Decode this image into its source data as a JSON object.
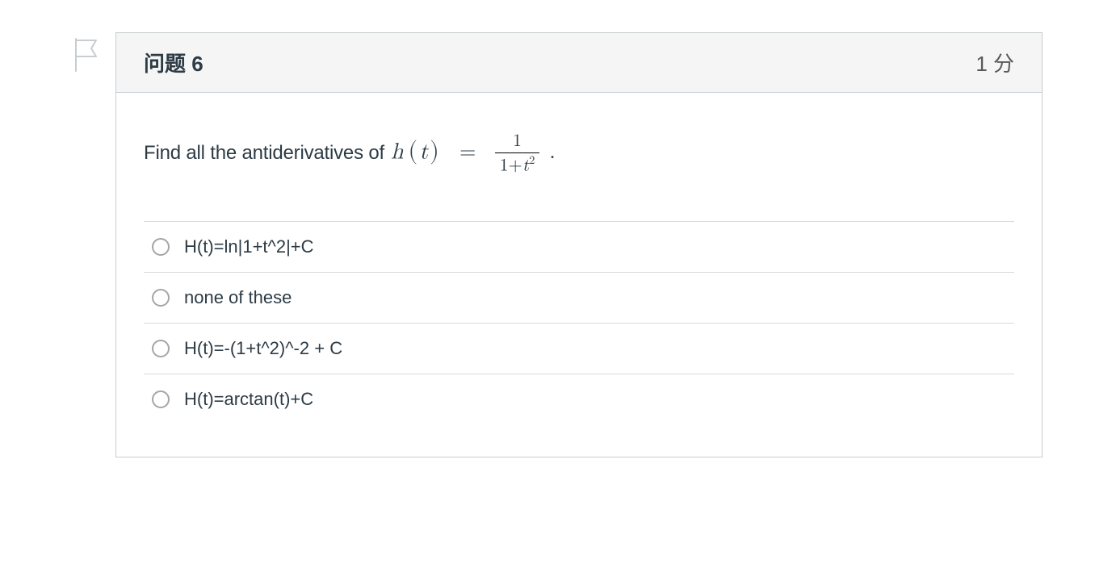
{
  "question": {
    "title": "问题 6",
    "points": "1 分",
    "prompt_prefix": "Find all the antiderivatives of",
    "math": {
      "func_letter": "h",
      "variable": "t",
      "equals": "=",
      "numerator": "1",
      "denom_const": "1",
      "denom_plus": "+",
      "denom_var": "t",
      "denom_exp": "2",
      "period": "."
    }
  },
  "answers": [
    {
      "label": "H(t)=ln|1+t^2|+C"
    },
    {
      "label": "none of these"
    },
    {
      "label": "H(t)=-(1+t^2)^-2 + C"
    },
    {
      "label": "H(t)=arctan(t)+C"
    }
  ]
}
